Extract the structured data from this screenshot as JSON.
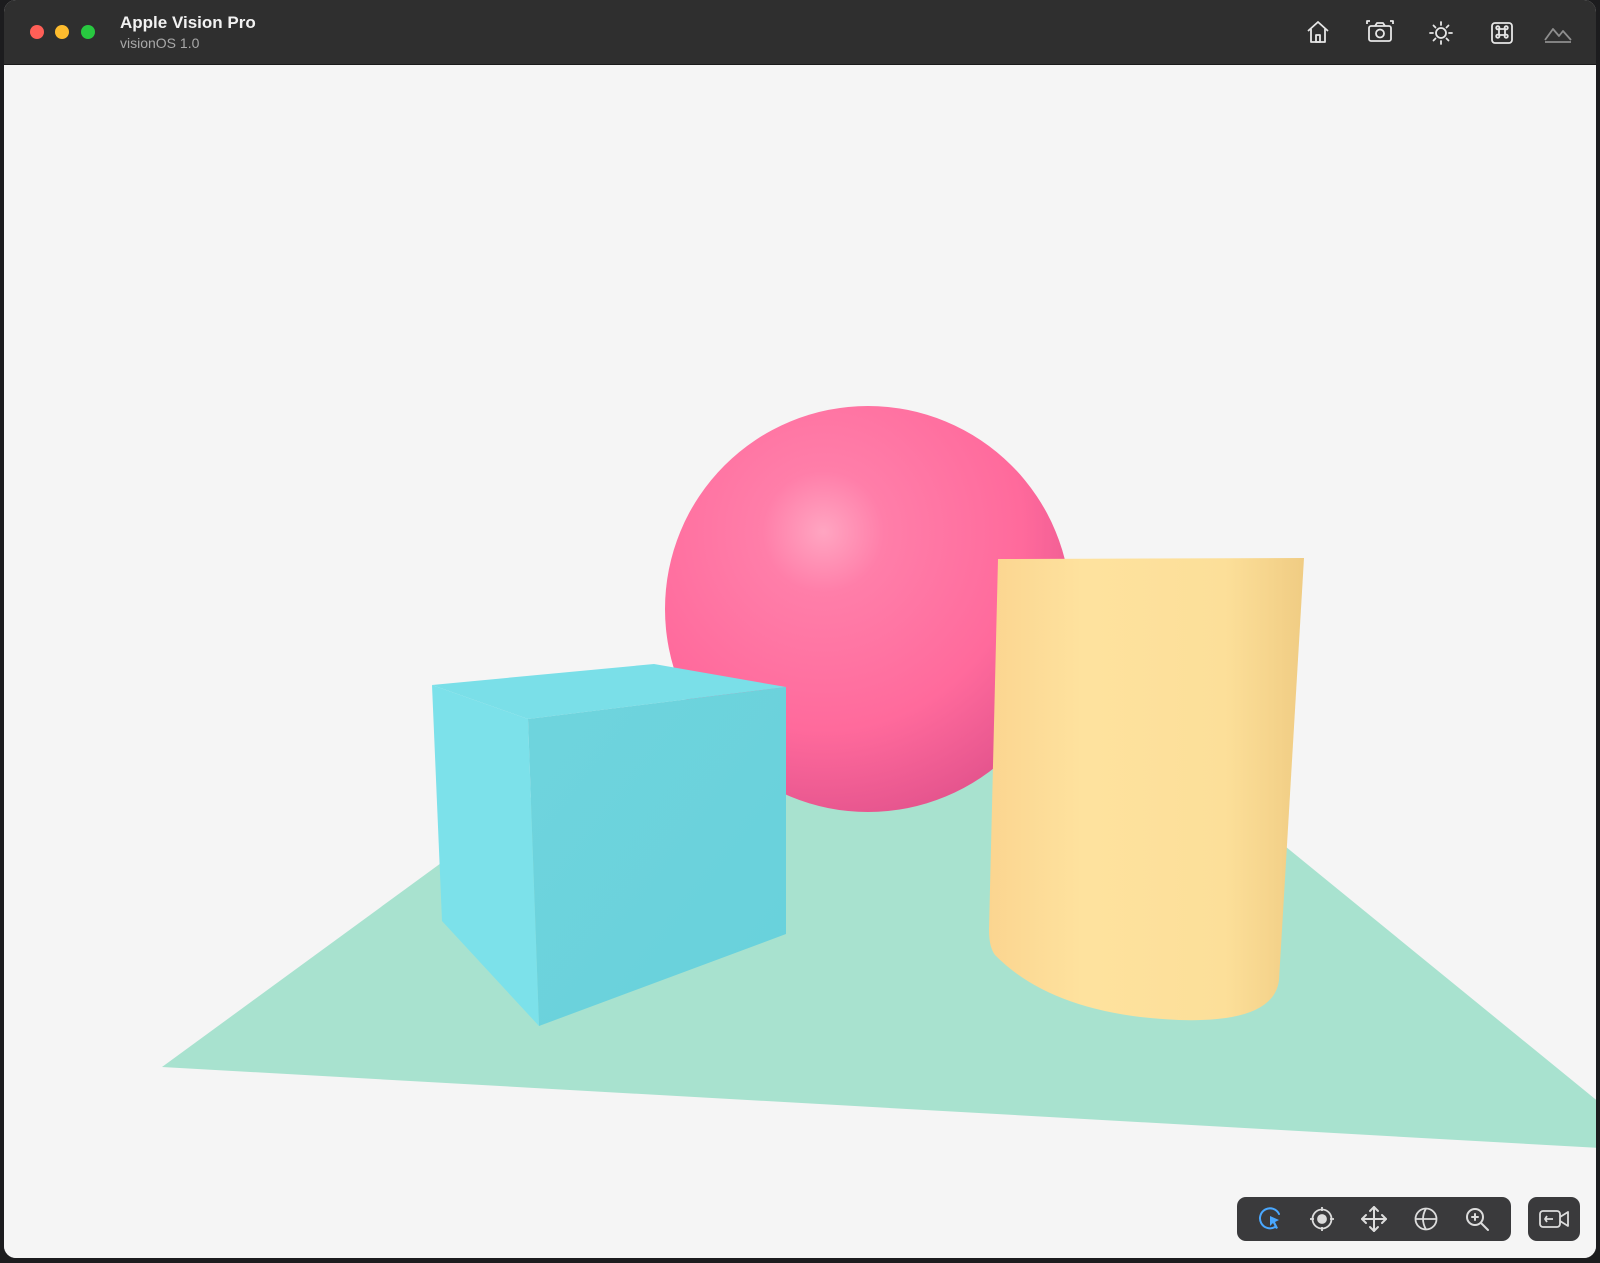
{
  "window": {
    "title": "Apple Vision Pro",
    "subtitle": "visionOS 1.0"
  },
  "titlebar_buttons": [
    {
      "name": "home-icon",
      "icon": "home"
    },
    {
      "name": "screenshot-icon",
      "icon": "camera"
    },
    {
      "name": "brightness-icon",
      "icon": "sun"
    },
    {
      "name": "command-icon",
      "icon": "command-key"
    },
    {
      "name": "environment-icon",
      "icon": "mountains"
    }
  ],
  "scene": {
    "objects": [
      "sphere",
      "cube",
      "cylinder",
      "ground-plane"
    ],
    "colors": {
      "sphere": "#ff6b9e",
      "cube": "#6dd8df",
      "cylinder": "#fde09a",
      "plane": "#a8e2cf",
      "background": "#f5f5f5"
    }
  },
  "interaction_tools": [
    {
      "name": "select-tool",
      "icon": "pointer-circle",
      "active": true
    },
    {
      "name": "orbit-tool",
      "icon": "orbit"
    },
    {
      "name": "pan-tool",
      "icon": "move-arrows"
    },
    {
      "name": "rotate-tool",
      "icon": "globe"
    },
    {
      "name": "zoom-tool",
      "icon": "magnifier"
    }
  ],
  "accent_color": "#4aa8ff"
}
